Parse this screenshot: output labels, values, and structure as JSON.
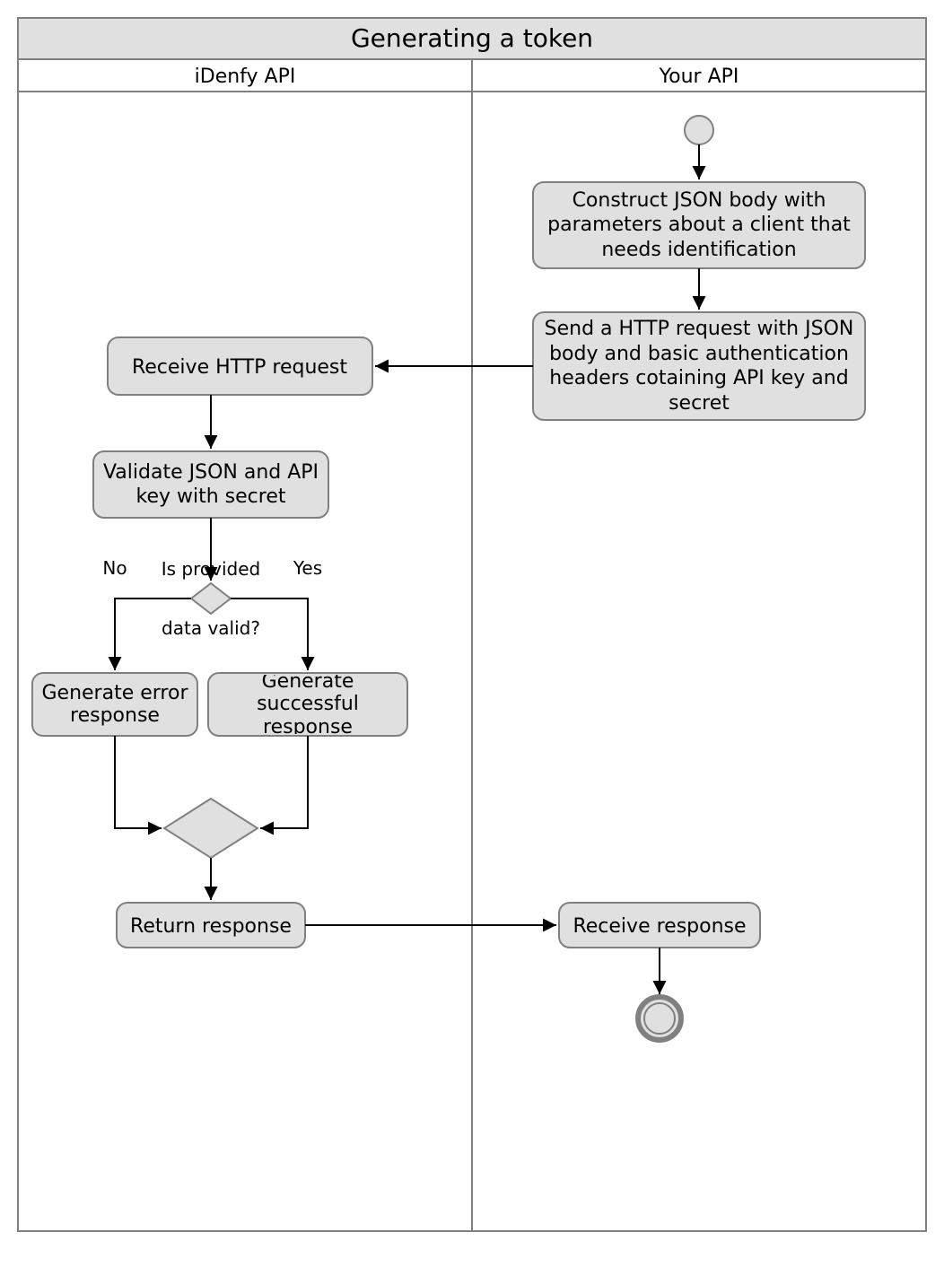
{
  "diagram": {
    "title": "Generating a token",
    "lanes": {
      "left": "iDenfy API",
      "right": "Your API"
    },
    "nodes": {
      "construct": "Construct JSON body with parameters about a client that needs identification",
      "send": "Send a HTTP request with JSON body and basic authentication headers cotaining API key and secret",
      "receive_http": "Receive HTTP request",
      "validate": "Validate JSON and API key with secret",
      "decision_q": "Is provided data valid?",
      "no": "No",
      "yes": "Yes",
      "gen_error": "Generate error response",
      "gen_success": "Generate successful response",
      "return_resp": "Return response",
      "receive_resp": "Receive response"
    }
  }
}
